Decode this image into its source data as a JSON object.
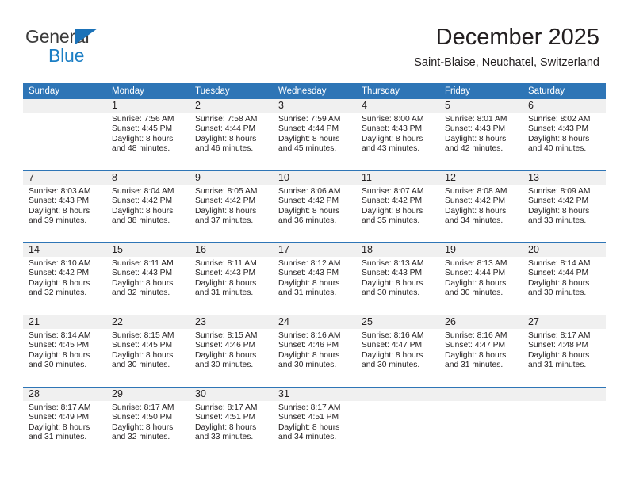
{
  "brand": {
    "name_part1": "General",
    "name_part2": "Blue",
    "accent_color": "#1b7ec4",
    "triangle_color": "#1b72b8"
  },
  "header": {
    "title": "December 2025",
    "subtitle": "Saint-Blaise, Neuchatel, Switzerland",
    "header_bg_color": "#2e75b6",
    "daynum_bg_color": "#f0f0f0"
  },
  "calendar": {
    "weekday_headers": [
      "Sunday",
      "Monday",
      "Tuesday",
      "Wednesday",
      "Thursday",
      "Friday",
      "Saturday"
    ],
    "weeks": [
      [
        {
          "day": "",
          "lines": []
        },
        {
          "day": "1",
          "lines": [
            "Sunrise: 7:56 AM",
            "Sunset: 4:45 PM",
            "Daylight: 8 hours",
            "and 48 minutes."
          ]
        },
        {
          "day": "2",
          "lines": [
            "Sunrise: 7:58 AM",
            "Sunset: 4:44 PM",
            "Daylight: 8 hours",
            "and 46 minutes."
          ]
        },
        {
          "day": "3",
          "lines": [
            "Sunrise: 7:59 AM",
            "Sunset: 4:44 PM",
            "Daylight: 8 hours",
            "and 45 minutes."
          ]
        },
        {
          "day": "4",
          "lines": [
            "Sunrise: 8:00 AM",
            "Sunset: 4:43 PM",
            "Daylight: 8 hours",
            "and 43 minutes."
          ]
        },
        {
          "day": "5",
          "lines": [
            "Sunrise: 8:01 AM",
            "Sunset: 4:43 PM",
            "Daylight: 8 hours",
            "and 42 minutes."
          ]
        },
        {
          "day": "6",
          "lines": [
            "Sunrise: 8:02 AM",
            "Sunset: 4:43 PM",
            "Daylight: 8 hours",
            "and 40 minutes."
          ]
        }
      ],
      [
        {
          "day": "7",
          "lines": [
            "Sunrise: 8:03 AM",
            "Sunset: 4:43 PM",
            "Daylight: 8 hours",
            "and 39 minutes."
          ]
        },
        {
          "day": "8",
          "lines": [
            "Sunrise: 8:04 AM",
            "Sunset: 4:42 PM",
            "Daylight: 8 hours",
            "and 38 minutes."
          ]
        },
        {
          "day": "9",
          "lines": [
            "Sunrise: 8:05 AM",
            "Sunset: 4:42 PM",
            "Daylight: 8 hours",
            "and 37 minutes."
          ]
        },
        {
          "day": "10",
          "lines": [
            "Sunrise: 8:06 AM",
            "Sunset: 4:42 PM",
            "Daylight: 8 hours",
            "and 36 minutes."
          ]
        },
        {
          "day": "11",
          "lines": [
            "Sunrise: 8:07 AM",
            "Sunset: 4:42 PM",
            "Daylight: 8 hours",
            "and 35 minutes."
          ]
        },
        {
          "day": "12",
          "lines": [
            "Sunrise: 8:08 AM",
            "Sunset: 4:42 PM",
            "Daylight: 8 hours",
            "and 34 minutes."
          ]
        },
        {
          "day": "13",
          "lines": [
            "Sunrise: 8:09 AM",
            "Sunset: 4:42 PM",
            "Daylight: 8 hours",
            "and 33 minutes."
          ]
        }
      ],
      [
        {
          "day": "14",
          "lines": [
            "Sunrise: 8:10 AM",
            "Sunset: 4:42 PM",
            "Daylight: 8 hours",
            "and 32 minutes."
          ]
        },
        {
          "day": "15",
          "lines": [
            "Sunrise: 8:11 AM",
            "Sunset: 4:43 PM",
            "Daylight: 8 hours",
            "and 32 minutes."
          ]
        },
        {
          "day": "16",
          "lines": [
            "Sunrise: 8:11 AM",
            "Sunset: 4:43 PM",
            "Daylight: 8 hours",
            "and 31 minutes."
          ]
        },
        {
          "day": "17",
          "lines": [
            "Sunrise: 8:12 AM",
            "Sunset: 4:43 PM",
            "Daylight: 8 hours",
            "and 31 minutes."
          ]
        },
        {
          "day": "18",
          "lines": [
            "Sunrise: 8:13 AM",
            "Sunset: 4:43 PM",
            "Daylight: 8 hours",
            "and 30 minutes."
          ]
        },
        {
          "day": "19",
          "lines": [
            "Sunrise: 8:13 AM",
            "Sunset: 4:44 PM",
            "Daylight: 8 hours",
            "and 30 minutes."
          ]
        },
        {
          "day": "20",
          "lines": [
            "Sunrise: 8:14 AM",
            "Sunset: 4:44 PM",
            "Daylight: 8 hours",
            "and 30 minutes."
          ]
        }
      ],
      [
        {
          "day": "21",
          "lines": [
            "Sunrise: 8:14 AM",
            "Sunset: 4:45 PM",
            "Daylight: 8 hours",
            "and 30 minutes."
          ]
        },
        {
          "day": "22",
          "lines": [
            "Sunrise: 8:15 AM",
            "Sunset: 4:45 PM",
            "Daylight: 8 hours",
            "and 30 minutes."
          ]
        },
        {
          "day": "23",
          "lines": [
            "Sunrise: 8:15 AM",
            "Sunset: 4:46 PM",
            "Daylight: 8 hours",
            "and 30 minutes."
          ]
        },
        {
          "day": "24",
          "lines": [
            "Sunrise: 8:16 AM",
            "Sunset: 4:46 PM",
            "Daylight: 8 hours",
            "and 30 minutes."
          ]
        },
        {
          "day": "25",
          "lines": [
            "Sunrise: 8:16 AM",
            "Sunset: 4:47 PM",
            "Daylight: 8 hours",
            "and 30 minutes."
          ]
        },
        {
          "day": "26",
          "lines": [
            "Sunrise: 8:16 AM",
            "Sunset: 4:47 PM",
            "Daylight: 8 hours",
            "and 31 minutes."
          ]
        },
        {
          "day": "27",
          "lines": [
            "Sunrise: 8:17 AM",
            "Sunset: 4:48 PM",
            "Daylight: 8 hours",
            "and 31 minutes."
          ]
        }
      ],
      [
        {
          "day": "28",
          "lines": [
            "Sunrise: 8:17 AM",
            "Sunset: 4:49 PM",
            "Daylight: 8 hours",
            "and 31 minutes."
          ]
        },
        {
          "day": "29",
          "lines": [
            "Sunrise: 8:17 AM",
            "Sunset: 4:50 PM",
            "Daylight: 8 hours",
            "and 32 minutes."
          ]
        },
        {
          "day": "30",
          "lines": [
            "Sunrise: 8:17 AM",
            "Sunset: 4:51 PM",
            "Daylight: 8 hours",
            "and 33 minutes."
          ]
        },
        {
          "day": "31",
          "lines": [
            "Sunrise: 8:17 AM",
            "Sunset: 4:51 PM",
            "Daylight: 8 hours",
            "and 34 minutes."
          ]
        },
        {
          "day": "",
          "lines": []
        },
        {
          "day": "",
          "lines": []
        },
        {
          "day": "",
          "lines": []
        }
      ]
    ]
  }
}
